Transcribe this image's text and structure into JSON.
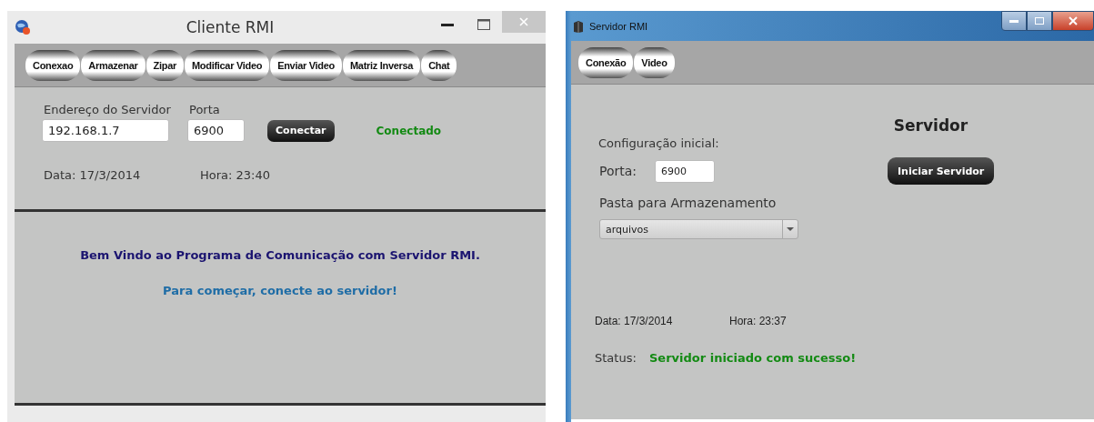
{
  "client_window": {
    "title": "Cliente RMI",
    "tabs": [
      {
        "label": "Conexao"
      },
      {
        "label": "Armazenar"
      },
      {
        "label": "Zipar"
      },
      {
        "label": "Modificar Video"
      },
      {
        "label": "Enviar Video"
      },
      {
        "label": "Matriz Inversa"
      },
      {
        "label": "Chat"
      }
    ],
    "server_address": {
      "label": "Endereço do Servidor",
      "value": "192.168.1.7"
    },
    "port": {
      "label": "Porta",
      "value": "6900"
    },
    "connect_button": "Conectar",
    "connection_status": "Conectado",
    "date": "Data: 17/3/2014",
    "time": "Hora: 23:40",
    "welcome": "Bem Vindo ao Programa de Comunicação com Servidor RMI.",
    "hint": "Para começar, conecte ao servidor!"
  },
  "server_window": {
    "title": "Servidor RMI",
    "tabs": [
      {
        "label": "Conexão"
      },
      {
        "label": "Video"
      }
    ],
    "heading": "Servidor",
    "config_label": "Configuração inicial:",
    "port": {
      "label": "Porta:",
      "value": "6900"
    },
    "start_button": "Iniciar Servidor",
    "folder": {
      "label": "Pasta para Armazenamento",
      "value": "arquivos"
    },
    "date": "Data: 17/3/2014",
    "time": "Hora: 23:37",
    "status_label": "Status:",
    "status": "Servidor iniciado com sucesso!"
  }
}
